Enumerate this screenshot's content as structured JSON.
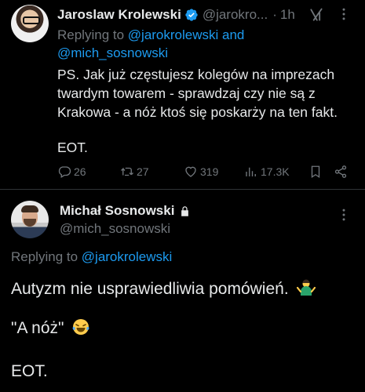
{
  "tweet1": {
    "author_name": "Jaroslaw Krolewski",
    "handle": "@jarokro...",
    "time_sep": "·",
    "time": "1h",
    "replying_prefix": "Replying to ",
    "replying_to_1": "@jarokrolewski",
    "replying_and": " and",
    "replying_to_2": "@mich_sosnowski",
    "text": "PS. Jak już częstujesz kolegów na imprezach twardym towarem - sprawdzaj czy nie są z Krakowa - a nóż ktoś się poskarży na ten fakt.",
    "eot": "EOT.",
    "replies": "26",
    "reposts": "27",
    "likes": "319",
    "views": "17.3K"
  },
  "tweet2": {
    "author_name": "Michał Sosnowski",
    "handle": "@mich_sosnowski",
    "replying_prefix": "Replying to ",
    "replying_to": "@jarokrolewski",
    "line1": "Autyzm nie usprawiedliwia pomówień.",
    "line2": "\"A nóż\"",
    "line3": "EOT."
  },
  "colors": {
    "background": "#000000",
    "text": "#e7e9ea",
    "secondary": "#71767b",
    "accent": "#1d9bf0",
    "divider": "#2f3336"
  },
  "icons": [
    "verified-badge-icon",
    "grok-icon",
    "more-icon",
    "reply-icon",
    "repost-icon",
    "like-icon",
    "views-icon",
    "bookmark-icon",
    "share-icon",
    "lock-icon",
    "shrug-emoji",
    "laughing-emoji"
  ]
}
